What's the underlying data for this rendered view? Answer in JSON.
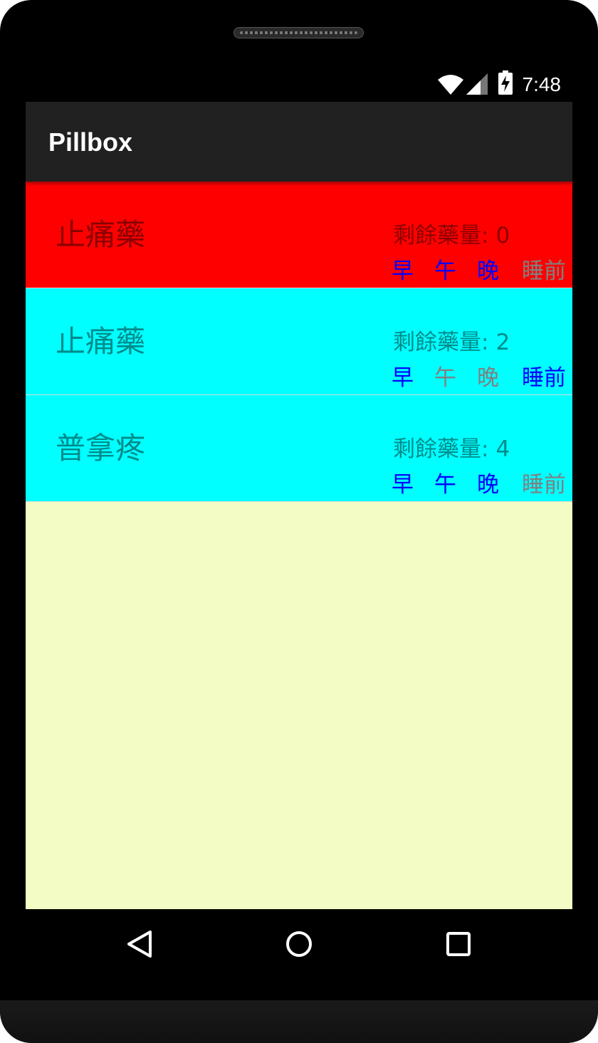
{
  "status_bar": {
    "time": "7:48",
    "icons": [
      "wifi-icon",
      "cell-signal-icon",
      "battery-charging-icon"
    ]
  },
  "app_bar": {
    "title": "Pillbox"
  },
  "remaining_label": "剩餘藥量:",
  "pills": [
    {
      "name": "止痛藥",
      "remaining": "0",
      "bg_color": "#ff0000",
      "text_color": "#8b0000",
      "times": [
        {
          "label": "早",
          "active": true
        },
        {
          "label": "午",
          "active": true
        },
        {
          "label": "晚",
          "active": true
        },
        {
          "label": "睡前",
          "active": false
        }
      ]
    },
    {
      "name": "止痛藥",
      "remaining": "2",
      "bg_color": "#00ffff",
      "text_color": "#008b8b",
      "times": [
        {
          "label": "早",
          "active": true
        },
        {
          "label": "午",
          "active": false
        },
        {
          "label": "晚",
          "active": false
        },
        {
          "label": "睡前",
          "active": true
        }
      ]
    },
    {
      "name": "普拿疼",
      "remaining": "4",
      "bg_color": "#00ffff",
      "text_color": "#008b8b",
      "times": [
        {
          "label": "早",
          "active": true
        },
        {
          "label": "午",
          "active": true
        },
        {
          "label": "晚",
          "active": true
        },
        {
          "label": "睡前",
          "active": false
        }
      ]
    }
  ],
  "colors": {
    "active_time": "#0000ff",
    "inactive_time": "#808080",
    "list_background": "#f2fcc4",
    "app_bar": "#212121"
  },
  "nav_bar": {
    "buttons": [
      "back-icon",
      "home-icon",
      "recents-icon"
    ]
  }
}
